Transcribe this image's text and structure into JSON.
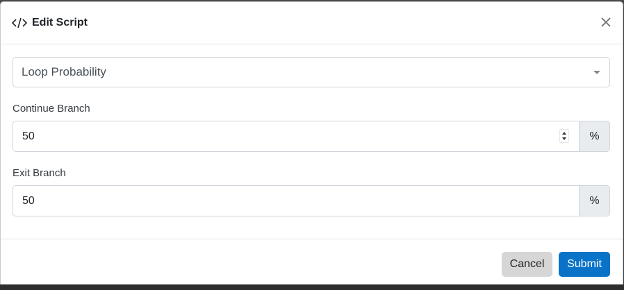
{
  "modal": {
    "title": "Edit Script",
    "title_icon": "code-icon",
    "close_icon": "close-icon"
  },
  "form": {
    "script_select": {
      "value": "Loop Probability"
    },
    "continue_branch": {
      "label": "Continue Branch",
      "value": "50",
      "unit": "%"
    },
    "exit_branch": {
      "label": "Exit Branch",
      "value": "50",
      "unit": "%"
    }
  },
  "footer": {
    "cancel_label": "Cancel",
    "submit_label": "Submit"
  },
  "colors": {
    "primary": "#0a73c8",
    "secondary": "#d6d6d6",
    "addon_bg": "#e9ecef"
  }
}
